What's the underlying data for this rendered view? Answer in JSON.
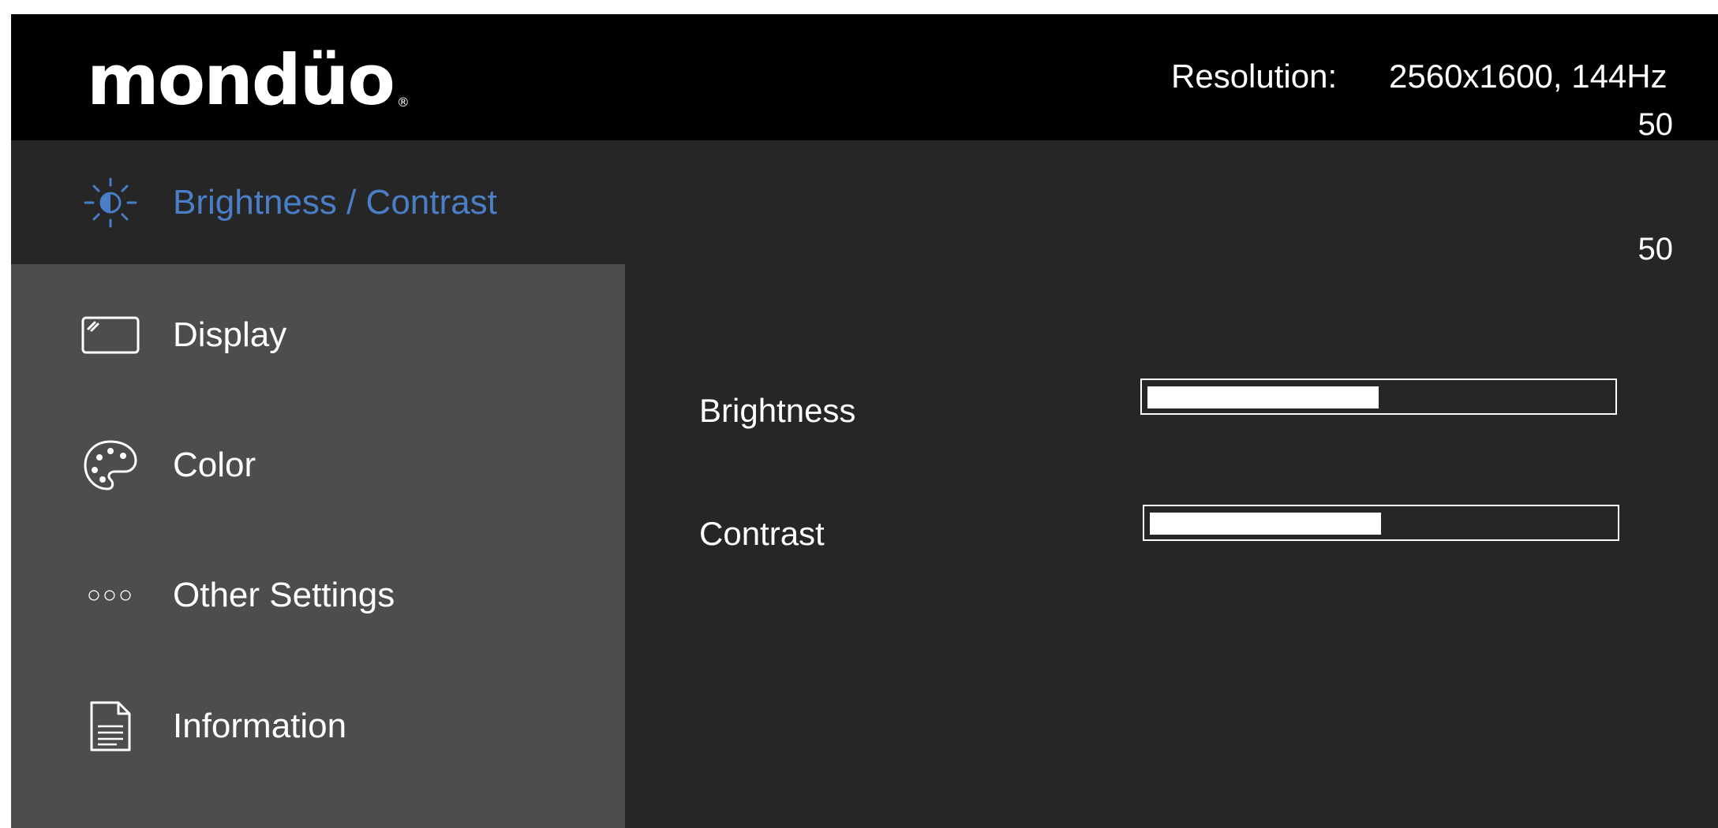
{
  "header": {
    "logo_text": "mondüo",
    "logo_mark": "®",
    "resolution_label": "Resolution:",
    "resolution_value": "2560x1600, 144Hz"
  },
  "readouts": {
    "brightness_value": "50",
    "contrast_value": "50"
  },
  "sidebar": {
    "items": [
      {
        "label": "Brightness / Contrast",
        "icon": "brightness-icon",
        "selected": true
      },
      {
        "label": "Display",
        "icon": "display-icon",
        "selected": false
      },
      {
        "label": "Color",
        "icon": "palette-icon",
        "selected": false
      },
      {
        "label": "Other Settings",
        "icon": "dots-icon",
        "selected": false,
        "icon_text": "○○○"
      },
      {
        "label": "Information",
        "icon": "document-icon",
        "selected": false
      }
    ]
  },
  "settings": {
    "brightness": {
      "label": "Brightness",
      "level": 50
    },
    "contrast": {
      "label": "Contrast",
      "level": 50
    }
  },
  "colors": {
    "accent": "#4a7fc8",
    "header_bg": "#000000",
    "panel_bg": "#262626",
    "sidebar_bg": "#4d4d4d",
    "text": "#ffffff"
  }
}
